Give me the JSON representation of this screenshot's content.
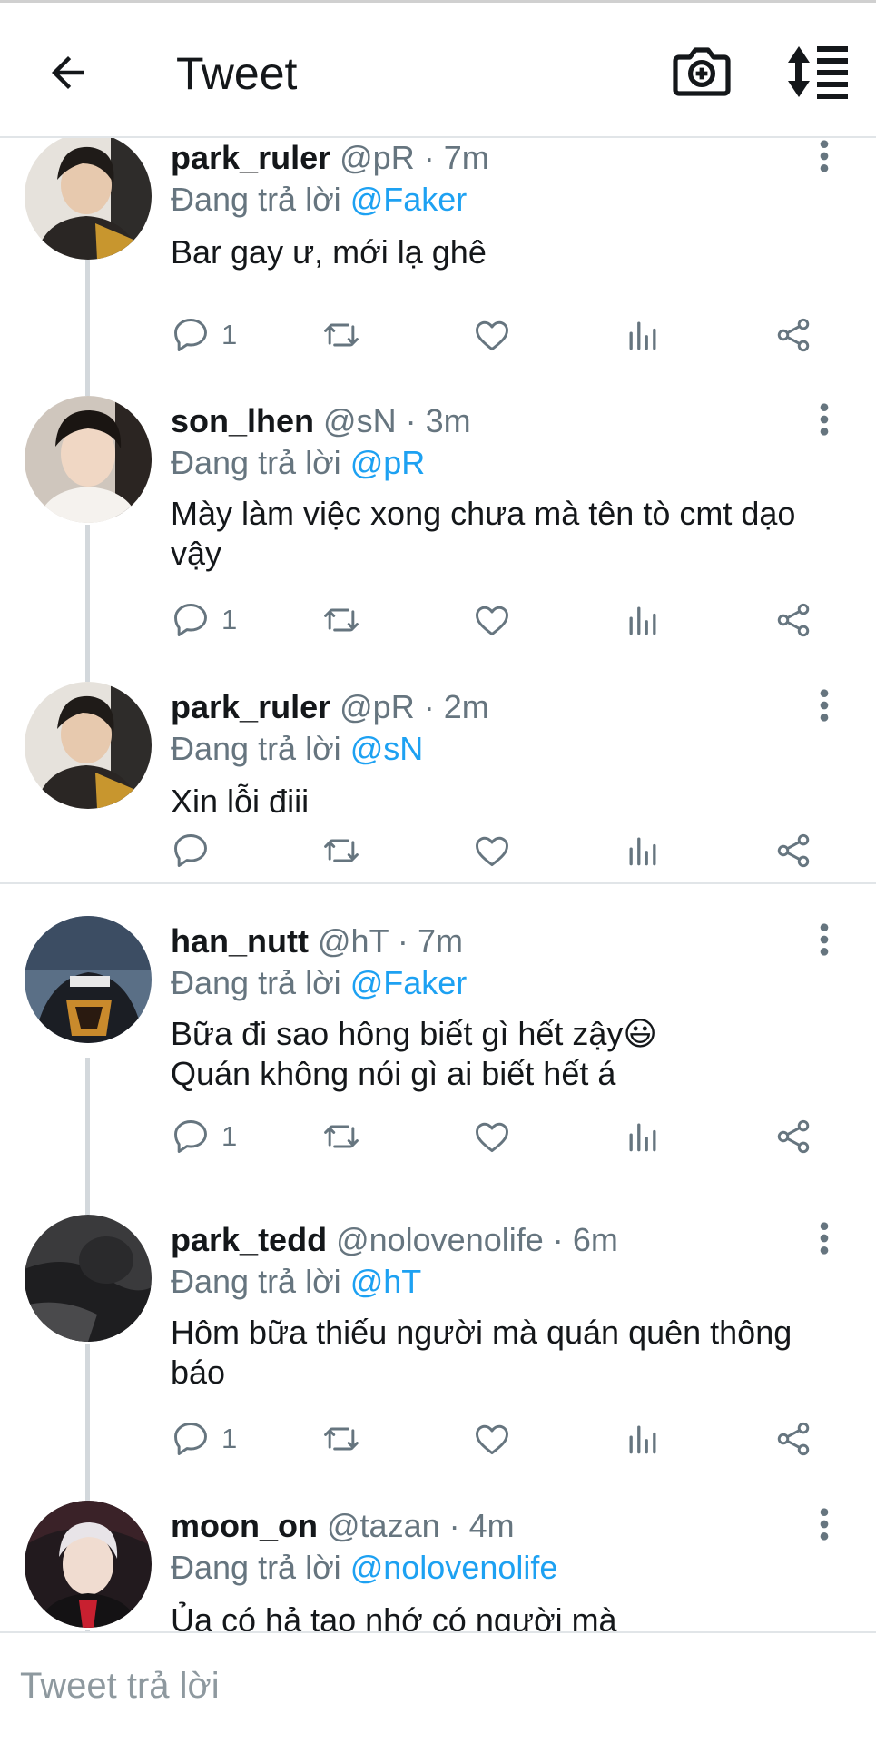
{
  "header": {
    "title": "Tweet",
    "icons": [
      "back-arrow-icon",
      "add-photo-camera-icon",
      "sort-replies-icon"
    ]
  },
  "tweets": [
    {
      "name": "park_ruler",
      "handle": "@pR",
      "sep": "·",
      "time": "7m",
      "replying_prefix": "Đang trả lời",
      "replying_to": "@Faker",
      "lines": [
        "Bar gay ư, mới lạ ghê"
      ],
      "replies": "1"
    },
    {
      "name": "son_lhen",
      "handle": "@sN",
      "sep": "·",
      "time": "3m",
      "replying_prefix": "Đang trả lời",
      "replying_to": "@pR",
      "lines": [
        "Mày làm việc xong chưa mà tên tò cmt dạo",
        "vậy"
      ],
      "replies": "1"
    },
    {
      "name": "park_ruler",
      "handle": "@pR",
      "sep": "·",
      "time": "2m",
      "replying_prefix": "Đang trả lời",
      "replying_to": "@sN",
      "lines": [
        "Xin lỗi điii"
      ],
      "replies": ""
    },
    {
      "name": "han_nutt",
      "handle": "@hT",
      "sep": "·",
      "time": "7m",
      "replying_prefix": "Đang trả lời",
      "replying_to": "@Faker",
      "lines": [
        "Bữa đi sao hông biết gì hết zậy😃",
        "Quán không nói gì ai biết hết á"
      ],
      "replies": "1"
    },
    {
      "name": "park_tedd",
      "handle": "@nolovenolife",
      "sep": "·",
      "time": "6m",
      "replying_prefix": "Đang trả lời",
      "replying_to": "@hT",
      "lines": [
        "Hôm bữa thiếu người mà quán quên thông",
        "báo"
      ],
      "replies": "1"
    },
    {
      "name": "moon_on",
      "handle": "@tazan",
      "sep": "·",
      "time": "4m",
      "replying_prefix": "Đang trả lời",
      "replying_to": "@nolovenolife",
      "lines": [
        "Ủa có hả tao nhớ có người mà"
      ],
      "replies": ""
    }
  ],
  "composer": {
    "placeholder": "Tweet trả lời"
  },
  "colors": {
    "mention": "#1da1f2",
    "secondary_text": "#66757f",
    "thread_line": "#d3d8dc"
  }
}
